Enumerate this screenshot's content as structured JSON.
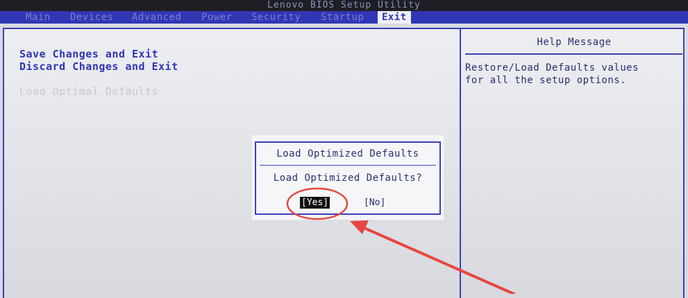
{
  "window": {
    "title": "Lenovo BIOS Setup Utility"
  },
  "menu": {
    "tabs": [
      {
        "label": "Main"
      },
      {
        "label": "Devices"
      },
      {
        "label": "Advanced"
      },
      {
        "label": "Power"
      },
      {
        "label": "Security"
      },
      {
        "label": "Startup"
      },
      {
        "label": "Exit"
      }
    ],
    "active": "Exit"
  },
  "exit_menu": {
    "items": [
      {
        "label": "Save Changes and Exit"
      },
      {
        "label": "Discard Changes and Exit"
      },
      {
        "label": "Load Optimal Defaults"
      }
    ]
  },
  "help": {
    "title": "Help Message",
    "text": "Restore/Load Defaults values\nfor all the setup options."
  },
  "dialog": {
    "title": "Load Optimized Defaults",
    "question": "Load Optimized Defaults?",
    "yes_label": "[Yes]",
    "no_label": "[No]"
  },
  "colors": {
    "menu_bar": "#3136b5",
    "frame_border": "#3a40b8",
    "annotation_red": "#e8463f"
  }
}
